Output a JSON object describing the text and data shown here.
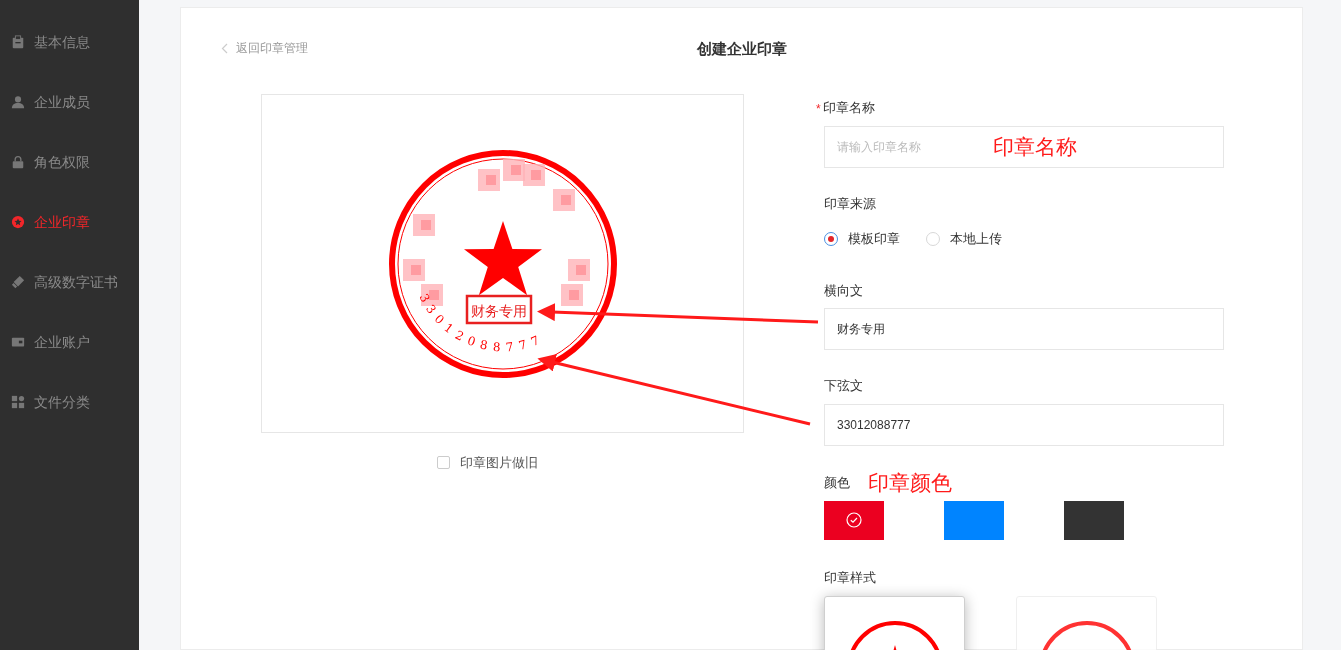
{
  "sidebar": {
    "items": [
      {
        "label": "基本信息",
        "selected": false
      },
      {
        "label": "企业成员",
        "selected": false
      },
      {
        "label": "角色权限",
        "selected": false
      },
      {
        "label": "企业印章",
        "selected": true
      },
      {
        "label": "高级数字证书",
        "selected": false
      },
      {
        "label": "企业账户",
        "selected": false
      },
      {
        "label": "文件分类",
        "selected": false
      }
    ]
  },
  "header": {
    "back_link": "返回印章管理",
    "title": "创建企业印章"
  },
  "preview": {
    "horizontal_text": "财务专用",
    "arc_text": "33012088777",
    "aged_checkbox": {
      "label": "印章图片做旧",
      "checked": false
    }
  },
  "form": {
    "name": {
      "label": "印章名称",
      "required_mark": "*",
      "placeholder": "请输入印章名称"
    },
    "source": {
      "label": "印章来源",
      "options": [
        {
          "label": "模板印章",
          "selected": true
        },
        {
          "label": "本地上传",
          "selected": false
        }
      ]
    },
    "horizontal": {
      "label": "横向文",
      "value": "财务专用"
    },
    "arc": {
      "label": "下弦文",
      "value": "33012088777"
    },
    "color": {
      "label": "颜色",
      "swatches": [
        {
          "color": "#eb0020",
          "selected": true
        },
        {
          "color": "#0084ff",
          "selected": false
        },
        {
          "color": "#333333",
          "selected": false
        }
      ]
    },
    "style": {
      "label": "印章样式",
      "options": [
        {
          "selected": true
        },
        {
          "selected": false
        }
      ]
    }
  },
  "annotations": [
    {
      "text": "印章名称"
    },
    {
      "text": "印章颜色"
    }
  ]
}
